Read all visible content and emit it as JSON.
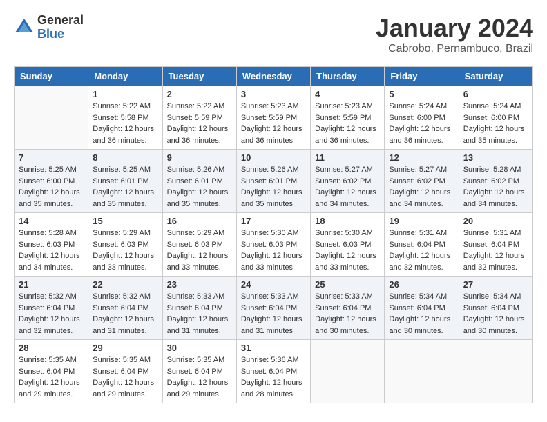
{
  "logo": {
    "general": "General",
    "blue": "Blue"
  },
  "title": {
    "month": "January 2024",
    "location": "Cabrobo, Pernambuco, Brazil"
  },
  "days_of_week": [
    "Sunday",
    "Monday",
    "Tuesday",
    "Wednesday",
    "Thursday",
    "Friday",
    "Saturday"
  ],
  "weeks": [
    [
      {
        "day": "",
        "empty": true
      },
      {
        "day": "1",
        "sunrise": "Sunrise: 5:22 AM",
        "sunset": "Sunset: 5:58 PM",
        "daylight": "Daylight: 12 hours and 36 minutes."
      },
      {
        "day": "2",
        "sunrise": "Sunrise: 5:22 AM",
        "sunset": "Sunset: 5:59 PM",
        "daylight": "Daylight: 12 hours and 36 minutes."
      },
      {
        "day": "3",
        "sunrise": "Sunrise: 5:23 AM",
        "sunset": "Sunset: 5:59 PM",
        "daylight": "Daylight: 12 hours and 36 minutes."
      },
      {
        "day": "4",
        "sunrise": "Sunrise: 5:23 AM",
        "sunset": "Sunset: 5:59 PM",
        "daylight": "Daylight: 12 hours and 36 minutes."
      },
      {
        "day": "5",
        "sunrise": "Sunrise: 5:24 AM",
        "sunset": "Sunset: 6:00 PM",
        "daylight": "Daylight: 12 hours and 36 minutes."
      },
      {
        "day": "6",
        "sunrise": "Sunrise: 5:24 AM",
        "sunset": "Sunset: 6:00 PM",
        "daylight": "Daylight: 12 hours and 35 minutes."
      }
    ],
    [
      {
        "day": "7",
        "sunrise": "Sunrise: 5:25 AM",
        "sunset": "Sunset: 6:00 PM",
        "daylight": "Daylight: 12 hours and 35 minutes."
      },
      {
        "day": "8",
        "sunrise": "Sunrise: 5:25 AM",
        "sunset": "Sunset: 6:01 PM",
        "daylight": "Daylight: 12 hours and 35 minutes."
      },
      {
        "day": "9",
        "sunrise": "Sunrise: 5:26 AM",
        "sunset": "Sunset: 6:01 PM",
        "daylight": "Daylight: 12 hours and 35 minutes."
      },
      {
        "day": "10",
        "sunrise": "Sunrise: 5:26 AM",
        "sunset": "Sunset: 6:01 PM",
        "daylight": "Daylight: 12 hours and 35 minutes."
      },
      {
        "day": "11",
        "sunrise": "Sunrise: 5:27 AM",
        "sunset": "Sunset: 6:02 PM",
        "daylight": "Daylight: 12 hours and 34 minutes."
      },
      {
        "day": "12",
        "sunrise": "Sunrise: 5:27 AM",
        "sunset": "Sunset: 6:02 PM",
        "daylight": "Daylight: 12 hours and 34 minutes."
      },
      {
        "day": "13",
        "sunrise": "Sunrise: 5:28 AM",
        "sunset": "Sunset: 6:02 PM",
        "daylight": "Daylight: 12 hours and 34 minutes."
      }
    ],
    [
      {
        "day": "14",
        "sunrise": "Sunrise: 5:28 AM",
        "sunset": "Sunset: 6:03 PM",
        "daylight": "Daylight: 12 hours and 34 minutes."
      },
      {
        "day": "15",
        "sunrise": "Sunrise: 5:29 AM",
        "sunset": "Sunset: 6:03 PM",
        "daylight": "Daylight: 12 hours and 33 minutes."
      },
      {
        "day": "16",
        "sunrise": "Sunrise: 5:29 AM",
        "sunset": "Sunset: 6:03 PM",
        "daylight": "Daylight: 12 hours and 33 minutes."
      },
      {
        "day": "17",
        "sunrise": "Sunrise: 5:30 AM",
        "sunset": "Sunset: 6:03 PM",
        "daylight": "Daylight: 12 hours and 33 minutes."
      },
      {
        "day": "18",
        "sunrise": "Sunrise: 5:30 AM",
        "sunset": "Sunset: 6:03 PM",
        "daylight": "Daylight: 12 hours and 33 minutes."
      },
      {
        "day": "19",
        "sunrise": "Sunrise: 5:31 AM",
        "sunset": "Sunset: 6:04 PM",
        "daylight": "Daylight: 12 hours and 32 minutes."
      },
      {
        "day": "20",
        "sunrise": "Sunrise: 5:31 AM",
        "sunset": "Sunset: 6:04 PM",
        "daylight": "Daylight: 12 hours and 32 minutes."
      }
    ],
    [
      {
        "day": "21",
        "sunrise": "Sunrise: 5:32 AM",
        "sunset": "Sunset: 6:04 PM",
        "daylight": "Daylight: 12 hours and 32 minutes."
      },
      {
        "day": "22",
        "sunrise": "Sunrise: 5:32 AM",
        "sunset": "Sunset: 6:04 PM",
        "daylight": "Daylight: 12 hours and 31 minutes."
      },
      {
        "day": "23",
        "sunrise": "Sunrise: 5:33 AM",
        "sunset": "Sunset: 6:04 PM",
        "daylight": "Daylight: 12 hours and 31 minutes."
      },
      {
        "day": "24",
        "sunrise": "Sunrise: 5:33 AM",
        "sunset": "Sunset: 6:04 PM",
        "daylight": "Daylight: 12 hours and 31 minutes."
      },
      {
        "day": "25",
        "sunrise": "Sunrise: 5:33 AM",
        "sunset": "Sunset: 6:04 PM",
        "daylight": "Daylight: 12 hours and 30 minutes."
      },
      {
        "day": "26",
        "sunrise": "Sunrise: 5:34 AM",
        "sunset": "Sunset: 6:04 PM",
        "daylight": "Daylight: 12 hours and 30 minutes."
      },
      {
        "day": "27",
        "sunrise": "Sunrise: 5:34 AM",
        "sunset": "Sunset: 6:04 PM",
        "daylight": "Daylight: 12 hours and 30 minutes."
      }
    ],
    [
      {
        "day": "28",
        "sunrise": "Sunrise: 5:35 AM",
        "sunset": "Sunset: 6:04 PM",
        "daylight": "Daylight: 12 hours and 29 minutes."
      },
      {
        "day": "29",
        "sunrise": "Sunrise: 5:35 AM",
        "sunset": "Sunset: 6:04 PM",
        "daylight": "Daylight: 12 hours and 29 minutes."
      },
      {
        "day": "30",
        "sunrise": "Sunrise: 5:35 AM",
        "sunset": "Sunset: 6:04 PM",
        "daylight": "Daylight: 12 hours and 29 minutes."
      },
      {
        "day": "31",
        "sunrise": "Sunrise: 5:36 AM",
        "sunset": "Sunset: 6:04 PM",
        "daylight": "Daylight: 12 hours and 28 minutes."
      },
      {
        "day": "",
        "empty": true
      },
      {
        "day": "",
        "empty": true
      },
      {
        "day": "",
        "empty": true
      }
    ]
  ]
}
